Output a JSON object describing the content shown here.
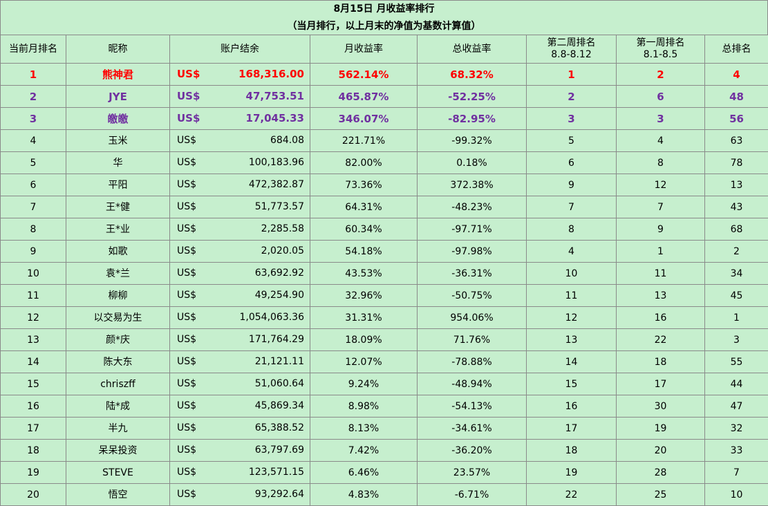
{
  "title": "8月15日 月收益率排行",
  "subtitle": "（当月排行，以上月末的净值为基数计算值）",
  "headers": {
    "rank": "当前月排名",
    "name": "昵称",
    "balance": "账户结余",
    "monthly_return": "月收益率",
    "total_return": "总收益率",
    "week2_line1": "第二周排名",
    "week2_line2": "8.8-8.12",
    "week1_line1": "第一周排名",
    "week1_line2": "8.1-8.5",
    "overall": "总排名"
  },
  "colors": {
    "background": "#c6efce",
    "grid": "#8a8a8a",
    "top1": "#ff0000",
    "top2_3": "#7030a0"
  },
  "rows": [
    {
      "rank": "1",
      "name": "熊神君",
      "currency": "US$",
      "balance": "168,316.00",
      "monthly": "562.14%",
      "total": "68.32%",
      "week2": "1",
      "week1": "2",
      "overall": "4",
      "style": "red"
    },
    {
      "rank": "2",
      "name": "JYE",
      "currency": "US$",
      "balance": "47,753.51",
      "monthly": "465.87%",
      "total": "-52.25%",
      "week2": "2",
      "week1": "6",
      "overall": "48",
      "style": "purple"
    },
    {
      "rank": "3",
      "name": "皦皦",
      "currency": "US$",
      "balance": "17,045.33",
      "monthly": "346.07%",
      "total": "-82.95%",
      "week2": "3",
      "week1": "3",
      "overall": "56",
      "style": "purple"
    },
    {
      "rank": "4",
      "name": "玉米",
      "currency": "US$",
      "balance": "684.08",
      "monthly": "221.71%",
      "total": "-99.32%",
      "week2": "5",
      "week1": "4",
      "overall": "63",
      "style": ""
    },
    {
      "rank": "5",
      "name": "华",
      "currency": "US$",
      "balance": "100,183.96",
      "monthly": "82.00%",
      "total": "0.18%",
      "week2": "6",
      "week1": "8",
      "overall": "78",
      "style": ""
    },
    {
      "rank": "6",
      "name": "平阳",
      "currency": "US$",
      "balance": "472,382.87",
      "monthly": "73.36%",
      "total": "372.38%",
      "week2": "9",
      "week1": "12",
      "overall": "13",
      "style": ""
    },
    {
      "rank": "7",
      "name": "王*健",
      "currency": "US$",
      "balance": "51,773.57",
      "monthly": "64.31%",
      "total": "-48.23%",
      "week2": "7",
      "week1": "7",
      "overall": "43",
      "style": ""
    },
    {
      "rank": "8",
      "name": "王*业",
      "currency": "US$",
      "balance": "2,285.58",
      "monthly": "60.34%",
      "total": "-97.71%",
      "week2": "8",
      "week1": "9",
      "overall": "68",
      "style": ""
    },
    {
      "rank": "9",
      "name": "如歌",
      "currency": "US$",
      "balance": "2,020.05",
      "monthly": "54.18%",
      "total": "-97.98%",
      "week2": "4",
      "week1": "1",
      "overall": "2",
      "style": ""
    },
    {
      "rank": "10",
      "name": "袁*兰",
      "currency": "US$",
      "balance": "63,692.92",
      "monthly": "43.53%",
      "total": "-36.31%",
      "week2": "10",
      "week1": "11",
      "overall": "34",
      "style": ""
    },
    {
      "rank": "11",
      "name": "柳柳",
      "currency": "US$",
      "balance": "49,254.90",
      "monthly": "32.96%",
      "total": "-50.75%",
      "week2": "11",
      "week1": "13",
      "overall": "45",
      "style": ""
    },
    {
      "rank": "12",
      "name": "以交易为生",
      "currency": "US$",
      "balance": "1,054,063.36",
      "monthly": "31.31%",
      "total": "954.06%",
      "week2": "12",
      "week1": "16",
      "overall": "1",
      "style": ""
    },
    {
      "rank": "13",
      "name": "颜*庆",
      "currency": "US$",
      "balance": "171,764.29",
      "monthly": "18.09%",
      "total": "71.76%",
      "week2": "13",
      "week1": "22",
      "overall": "3",
      "style": ""
    },
    {
      "rank": "14",
      "name": "陈大东",
      "currency": "US$",
      "balance": "21,121.11",
      "monthly": "12.07%",
      "total": "-78.88%",
      "week2": "14",
      "week1": "18",
      "overall": "55",
      "style": ""
    },
    {
      "rank": "15",
      "name": "chriszff",
      "currency": "US$",
      "balance": "51,060.64",
      "monthly": "9.24%",
      "total": "-48.94%",
      "week2": "15",
      "week1": "17",
      "overall": "44",
      "style": ""
    },
    {
      "rank": "16",
      "name": "陆*成",
      "currency": "US$",
      "balance": "45,869.34",
      "monthly": "8.98%",
      "total": "-54.13%",
      "week2": "16",
      "week1": "30",
      "overall": "47",
      "style": ""
    },
    {
      "rank": "17",
      "name": "半九",
      "currency": "US$",
      "balance": "65,388.52",
      "monthly": "8.13%",
      "total": "-34.61%",
      "week2": "17",
      "week1": "19",
      "overall": "32",
      "style": ""
    },
    {
      "rank": "18",
      "name": "呆呆投资",
      "currency": "US$",
      "balance": "63,797.69",
      "monthly": "7.42%",
      "total": "-36.20%",
      "week2": "18",
      "week1": "20",
      "overall": "33",
      "style": ""
    },
    {
      "rank": "19",
      "name": "STEVE",
      "currency": "US$",
      "balance": "123,571.15",
      "monthly": "6.46%",
      "total": "23.57%",
      "week2": "19",
      "week1": "28",
      "overall": "7",
      "style": ""
    },
    {
      "rank": "20",
      "name": "悟空",
      "currency": "US$",
      "balance": "93,292.64",
      "monthly": "4.83%",
      "total": "-6.71%",
      "week2": "22",
      "week1": "25",
      "overall": "10",
      "style": ""
    }
  ]
}
